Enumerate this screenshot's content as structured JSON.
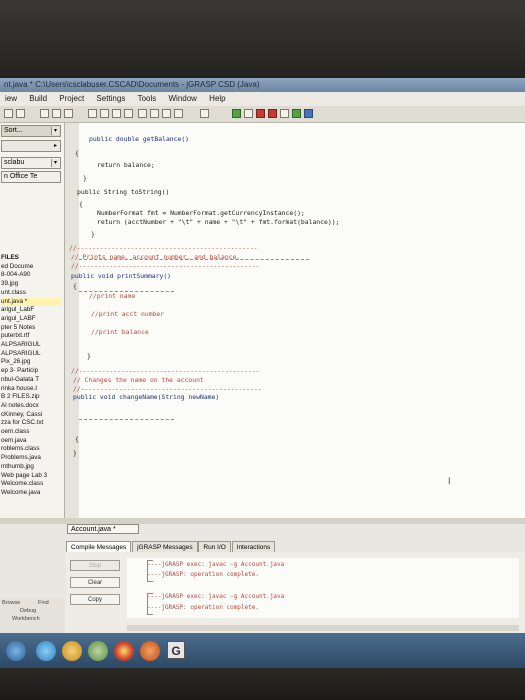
{
  "window": {
    "title": "nt.java * C:\\Users\\csclabuser.CSCAD\\Documents - jGRASP CSD (Java)"
  },
  "menu": [
    "iew",
    "Build",
    "Project",
    "Settings",
    "Tools",
    "Window",
    "Help"
  ],
  "sidebar": {
    "sort_label": "Sort...",
    "filter_label": "sclabu",
    "folder_label": "n Office Te",
    "files": [
      "FILES",
      "ed Docume",
      "8-004-A90",
      "39.jpg",
      "unt.class",
      "unt.java *",
      "arigul_LabF",
      "arigul_LABF",
      "pter 5 Notes",
      "putertxt.rtf",
      "ALPSARIGUL",
      "ALPSARIGUL",
      "Pix_26.jpg",
      "ep 3- Particip",
      "nbul-Galata T",
      "rinka house.I",
      "B 2 FILES.zip",
      "Al notes.docx",
      "cKinney, Cassi",
      "zza for CSC.txt",
      "oem.class",
      "oem.java",
      "roblems.class",
      "Problems.java",
      "mthumb.jpg",
      "Web page Lab 3",
      "Welcome.class",
      "Welcome.java"
    ]
  },
  "code": {
    "l1": "public double getBalance()",
    "l2": "{",
    "l3": "return balance;",
    "l4": "}",
    "l5": "public String toString()",
    "l6": "{",
    "l7": "NumberFormat fmt = NumberFormat.getCurrencyInstance();",
    "l8": "return (acctNumber + \"\\t\" + name + \"\\t\" + fmt.format(balance));",
    "l9": "}",
    "c1": "//-----------------------------------------------",
    "c2": "// Prints name, account number, and balance.",
    "c3": "//-----------------------------------------------",
    "l10": "public void printSummary()",
    "l11": "{",
    "c4": "//print name",
    "c5": "//print acct number",
    "c6": "//print balance",
    "l12": "}",
    "c7": "//-----------------------------------------------",
    "c8": "// Changes the name on the account",
    "c9": "//-----------------------------------------------",
    "l13": "public void changeName(String newName)",
    "l14": "{",
    "l15": "}",
    "l16": "}"
  },
  "file_tab": "Account.java *",
  "messages": {
    "tabs": [
      "Compile Messages",
      "jGRASP Messages",
      "Run I/O",
      "Interactions"
    ],
    "buttons": {
      "stop": "Stop",
      "clear": "Clear",
      "copy": "Copy"
    },
    "lines": [
      "----jGRASP exec: javac -g Account.java",
      "----jGRASP: operation complete.",
      "----jGRASP exec: javac -g Account.java",
      "----jGRASP: operation complete."
    ]
  },
  "bottom_left": {
    "browse": "Browse",
    "find": "Find",
    "debug": "Debug",
    "workbench": "Workbench"
  },
  "taskbar": {
    "app_letter": "G"
  }
}
